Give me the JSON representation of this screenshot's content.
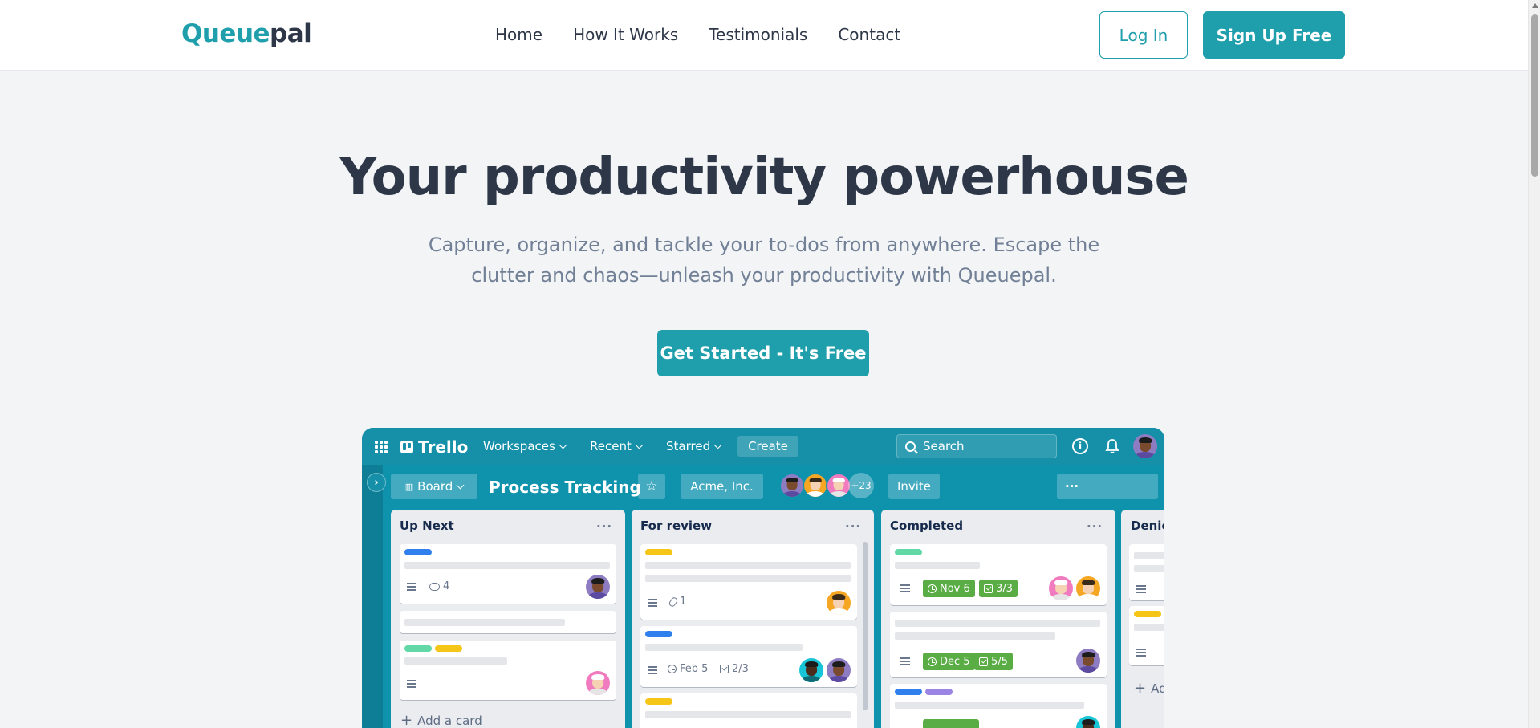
{
  "nav": {
    "logo_part1": "Queue",
    "logo_part2": "pal",
    "links": [
      "Home",
      "How It Works",
      "Testimonials",
      "Contact"
    ],
    "login": "Log In",
    "signup": "Sign Up Free"
  },
  "hero": {
    "title": "Your productivity powerhouse",
    "subtitle": "Capture, organize, and tackle your to-dos from anywhere. Escape the clutter and chaos—unleash your productivity with Queuepal.",
    "cta": "Get Started - It's Free"
  },
  "board": {
    "app_name": "Trello",
    "menus": [
      "Workspaces",
      "Recent",
      "Starred"
    ],
    "create": "Create",
    "search_placeholder": "Search",
    "view": "Board",
    "title": "Process Tracking",
    "workspace": "Acme, Inc.",
    "member_extra": "+23",
    "invite": "Invite",
    "more": "···",
    "lists": [
      {
        "title": "Up Next",
        "comment_count": "4",
        "add_card": "Add a card"
      },
      {
        "title": "For review",
        "attachment_count": "1",
        "due": "Feb 5",
        "checklist": "2/3"
      },
      {
        "title": "Completed",
        "due1": "Nov 6",
        "check1": "3/3",
        "due2": "Dec 5",
        "check2": "5/5"
      },
      {
        "title": "Denie",
        "add_card": "Ad"
      }
    ]
  },
  "colors": {
    "brand": "#1f9eab",
    "text": "#2d3748",
    "board_bg": "#0f93ad",
    "label_blue": "#2f80ed",
    "label_yellow": "#f5c518",
    "label_green": "#61d8a6",
    "label_purple": "#9a85e4",
    "due_green": "#5aac44"
  }
}
